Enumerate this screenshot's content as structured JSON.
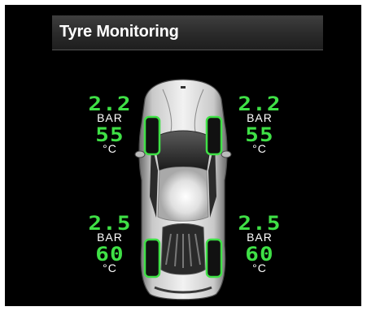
{
  "title": "Tyre Monitoring",
  "tyres": {
    "front_left": {
      "pressure": "2.2",
      "pressure_unit": "BAR",
      "temperature": "55",
      "temperature_unit": "°C"
    },
    "front_right": {
      "pressure": "2.2",
      "pressure_unit": "BAR",
      "temperature": "55",
      "temperature_unit": "°C"
    },
    "rear_left": {
      "pressure": "2.5",
      "pressure_unit": "BAR",
      "temperature": "60",
      "temperature_unit": "°C"
    },
    "rear_right": {
      "pressure": "2.5",
      "pressure_unit": "BAR",
      "temperature": "60",
      "temperature_unit": "°C"
    }
  },
  "colors": {
    "accent": "#3fe046",
    "background": "#000000",
    "title_bar": "#2f2f2f"
  },
  "icons": {
    "car": "car-top-view-icon"
  }
}
